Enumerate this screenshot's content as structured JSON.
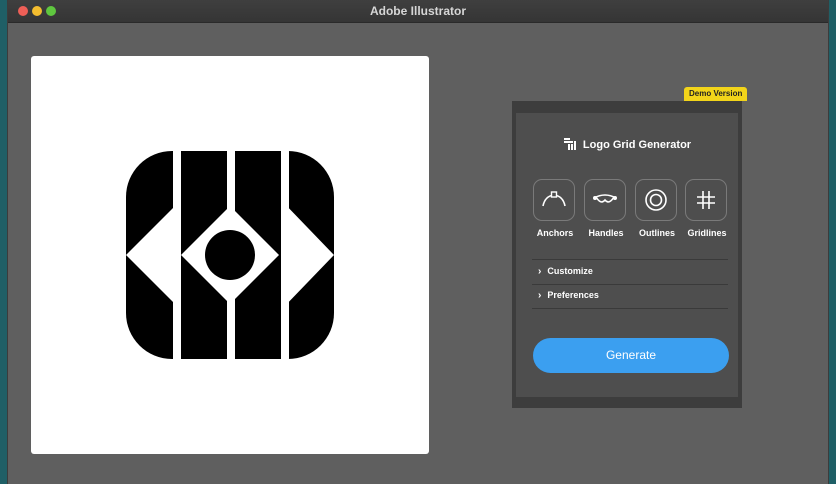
{
  "window": {
    "title": "Adobe Illustrator"
  },
  "panel": {
    "badge": "Demo Version",
    "title": "Logo Grid Generator",
    "tools": [
      {
        "label": "Anchors",
        "icon": "anchor-point-icon"
      },
      {
        "label": "Handles",
        "icon": "bezier-handles-icon"
      },
      {
        "label": "Outlines",
        "icon": "concentric-circles-icon"
      },
      {
        "label": "Gridlines",
        "icon": "grid-lines-icon"
      }
    ],
    "sections": [
      {
        "label": "Customize"
      },
      {
        "label": "Preferences"
      }
    ],
    "generate_label": "Generate"
  },
  "colors": {
    "accent": "#3b9ff0",
    "badge": "#f2d41a",
    "panel": "#4e4e4e",
    "workspace": "#5f5f5f"
  }
}
